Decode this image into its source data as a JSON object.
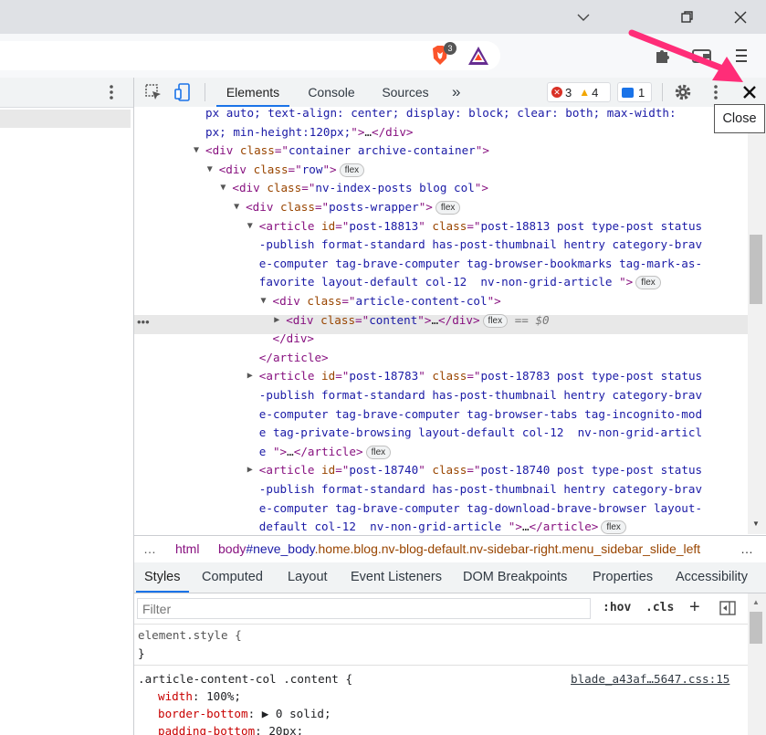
{
  "window": {
    "minimize_icon": "chevron-down-icon",
    "restore_icon": "restore-icon",
    "close_icon": "close-icon"
  },
  "browser": {
    "brave_shield_count": "3"
  },
  "devtools": {
    "tabs": [
      "Elements",
      "Console",
      "Sources"
    ],
    "more_tabs": "»",
    "errors": "3",
    "warnings": "4",
    "messages": "1",
    "close_tooltip": "Close",
    "dom_lines": [
      {
        "indent": 0,
        "tri": "",
        "parts": [
          [
            "av",
            "px auto; text-align: center; display: block; clear: both; max-width:"
          ]
        ]
      },
      {
        "indent": 0,
        "tri": "",
        "parts": [
          [
            "av",
            "px; min-height:120px;"
          ],
          [
            "tag",
            "\">"
          ],
          [
            "tx",
            "…"
          ],
          [
            "tag",
            "</div>"
          ]
        ]
      },
      {
        "indent": 0,
        "tri": "▼",
        "parts": [
          [
            "tag",
            "<div "
          ],
          [
            "an",
            "class"
          ],
          [
            "tag",
            "=\""
          ],
          [
            "av",
            "container archive-container"
          ],
          [
            "tag",
            "\">"
          ]
        ]
      },
      {
        "indent": 1,
        "tri": "▼",
        "parts": [
          [
            "tag",
            "<div "
          ],
          [
            "an",
            "class"
          ],
          [
            "tag",
            "=\""
          ],
          [
            "av",
            "row"
          ],
          [
            "tag",
            "\">"
          ]
        ],
        "flex": "flex"
      },
      {
        "indent": 2,
        "tri": "▼",
        "parts": [
          [
            "tag",
            "<div "
          ],
          [
            "an",
            "class"
          ],
          [
            "tag",
            "=\""
          ],
          [
            "av",
            "nv-index-posts blog col"
          ],
          [
            "tag",
            "\">"
          ]
        ]
      },
      {
        "indent": 3,
        "tri": "▼",
        "parts": [
          [
            "tag",
            "<div "
          ],
          [
            "an",
            "class"
          ],
          [
            "tag",
            "=\""
          ],
          [
            "av",
            "posts-wrapper"
          ],
          [
            "tag",
            "\">"
          ]
        ],
        "flex": "flex"
      },
      {
        "indent": 4,
        "tri": "▼",
        "parts": [
          [
            "tag",
            "<article "
          ],
          [
            "an",
            "id"
          ],
          [
            "tag",
            "=\""
          ],
          [
            "av",
            "post-18813"
          ],
          [
            "tag",
            "\" "
          ],
          [
            "an",
            "class"
          ],
          [
            "tag",
            "=\""
          ],
          [
            "av",
            "post-18813 post type-post status"
          ]
        ]
      },
      {
        "indent": 4,
        "tri": "",
        "parts": [
          [
            "av",
            "-publish format-standard has-post-thumbnail hentry category-brav"
          ]
        ]
      },
      {
        "indent": 4,
        "tri": "",
        "parts": [
          [
            "av",
            "e-computer tag-brave-computer tag-browser-bookmarks tag-mark-as-"
          ]
        ]
      },
      {
        "indent": 4,
        "tri": "",
        "parts": [
          [
            "av",
            "favorite layout-default col-12  nv-non-grid-article "
          ],
          [
            "tag",
            "\">"
          ]
        ],
        "flex": "flex"
      },
      {
        "indent": 5,
        "tri": "▼",
        "parts": [
          [
            "tag",
            "<div "
          ],
          [
            "an",
            "class"
          ],
          [
            "tag",
            "=\""
          ],
          [
            "av",
            "article-content-col"
          ],
          [
            "tag",
            "\">"
          ]
        ]
      },
      {
        "indent": 6,
        "tri": "▶",
        "parts": [
          [
            "tag",
            "<div "
          ],
          [
            "an",
            "class"
          ],
          [
            "tag",
            "=\""
          ],
          [
            "av",
            "content"
          ],
          [
            "tag",
            "\">"
          ],
          [
            "tx",
            "…"
          ],
          [
            "tag",
            "</div>"
          ]
        ],
        "flex": "flex",
        "selected": "== $0"
      },
      {
        "indent": 5,
        "tri": "",
        "parts": [
          [
            "tag",
            "</div>"
          ]
        ]
      },
      {
        "indent": 4,
        "tri": "",
        "parts": [
          [
            "tag",
            "</article>"
          ]
        ]
      },
      {
        "indent": 4,
        "tri": "▶",
        "parts": [
          [
            "tag",
            "<article "
          ],
          [
            "an",
            "id"
          ],
          [
            "tag",
            "=\""
          ],
          [
            "av",
            "post-18783"
          ],
          [
            "tag",
            "\" "
          ],
          [
            "an",
            "class"
          ],
          [
            "tag",
            "=\""
          ],
          [
            "av",
            "post-18783 post type-post status"
          ]
        ]
      },
      {
        "indent": 4,
        "tri": "",
        "parts": [
          [
            "av",
            "-publish format-standard has-post-thumbnail hentry category-brav"
          ]
        ]
      },
      {
        "indent": 4,
        "tri": "",
        "parts": [
          [
            "av",
            "e-computer tag-brave-computer tag-browser-tabs tag-incognito-mod"
          ]
        ]
      },
      {
        "indent": 4,
        "tri": "",
        "parts": [
          [
            "av",
            "e tag-private-browsing layout-default col-12  nv-non-grid-articl"
          ]
        ]
      },
      {
        "indent": 4,
        "tri": "",
        "parts": [
          [
            "av",
            "e "
          ],
          [
            "tag",
            "\">"
          ],
          [
            "tx",
            "…"
          ],
          [
            "tag",
            "</article>"
          ]
        ],
        "flex": "flex"
      },
      {
        "indent": 4,
        "tri": "▶",
        "parts": [
          [
            "tag",
            "<article "
          ],
          [
            "an",
            "id"
          ],
          [
            "tag",
            "=\""
          ],
          [
            "av",
            "post-18740"
          ],
          [
            "tag",
            "\" "
          ],
          [
            "an",
            "class"
          ],
          [
            "tag",
            "=\""
          ],
          [
            "av",
            "post-18740 post type-post status"
          ]
        ]
      },
      {
        "indent": 4,
        "tri": "",
        "parts": [
          [
            "av",
            "-publish format-standard has-post-thumbnail hentry category-brav"
          ]
        ]
      },
      {
        "indent": 4,
        "tri": "",
        "parts": [
          [
            "av",
            "e-computer tag-brave-computer tag-download-brave-browser layout-"
          ]
        ]
      },
      {
        "indent": 4,
        "tri": "",
        "parts": [
          [
            "av",
            "default col-12  nv-non-grid-article "
          ],
          [
            "tag",
            "\">"
          ],
          [
            "tx",
            "…"
          ],
          [
            "tag",
            "</article>"
          ]
        ],
        "flex": "flex"
      }
    ],
    "breadcrumb": {
      "ellipsis": "…",
      "html": "html",
      "body_tag": "body",
      "body_id": "#neve_body",
      "body_classes": ".home.blog.nv-blog-default.nv-sidebar-right.menu_sidebar_slide_left",
      "more": "…"
    },
    "style_tabs": [
      "Styles",
      "Computed",
      "Layout",
      "Event Listeners",
      "DOM Breakpoints",
      "Properties",
      "Accessibility"
    ],
    "filter_placeholder": "Filter",
    "hov": ":hov",
    "cls": ".cls",
    "element_style": "element.style {",
    "close_brace": "}",
    "rule_selector": ".article-content-col .content {",
    "rule_source": "blade_a43af…5647.css:15",
    "rule_props": [
      {
        "name": "width",
        "value": "100%;"
      },
      {
        "name": "border-bottom",
        "value": "▶ 0 solid;"
      },
      {
        "name": "padding-bottom",
        "value": "20px;"
      }
    ]
  }
}
